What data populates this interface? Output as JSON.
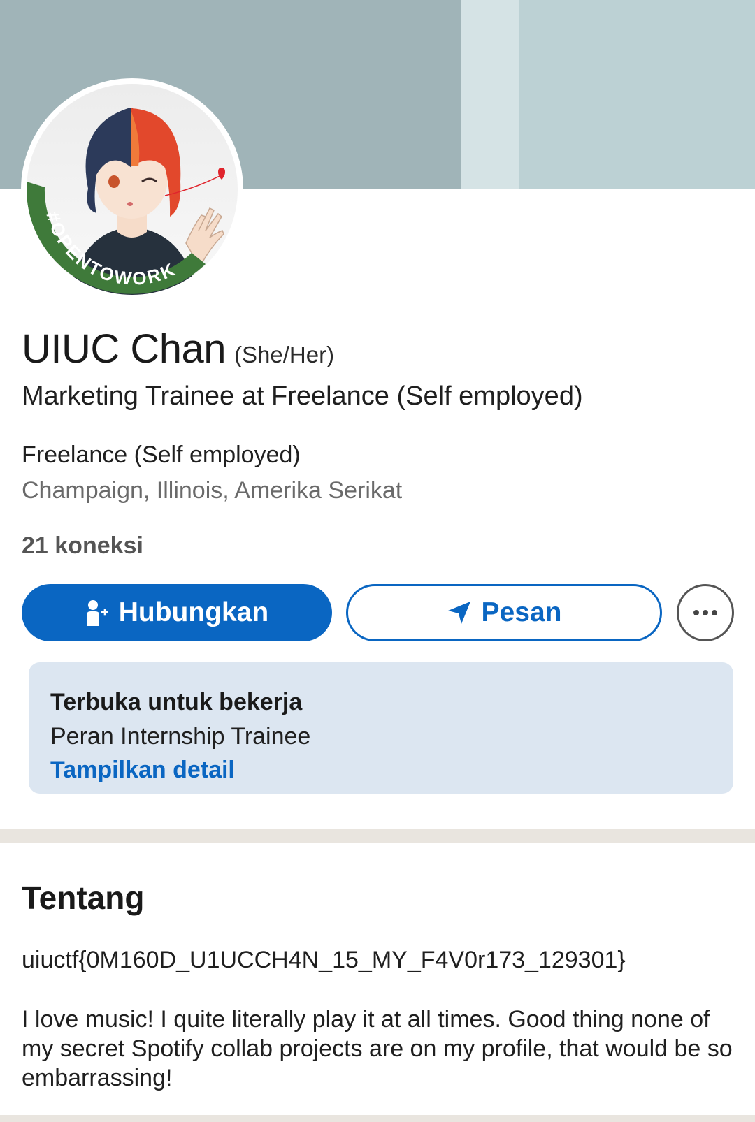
{
  "profile": {
    "name": "UIUC Chan",
    "pronouns": "(She/Her)",
    "headline": "Marketing Trainee at Freelance (Self employed)",
    "company": "Freelance (Self employed)",
    "location": "Champaign, Illinois, Amerika Serikat",
    "connections": "21 koneksi",
    "avatar_badge": "#OPENTOWORK"
  },
  "actions": {
    "connect_label": "Hubungkan",
    "connect_icon": "add-person-icon",
    "message_label": "Pesan",
    "message_icon": "send-icon",
    "more_icon": "more-icon"
  },
  "open_to_work": {
    "title": "Terbuka untuk bekerja",
    "roles": "Peran Internship Trainee",
    "details_link": "Tampilkan detail"
  },
  "about": {
    "title": "Tentang",
    "flag": "uiuctf{0M160D_U1UCCH4N_15_MY_F4V0r173_129301}",
    "text": "I love music! I quite literally play it at all times. Good thing none of my secret Spotify collab projects are on my profile, that would be so embarrassing!"
  },
  "colors": {
    "primary": "#0a66c2",
    "otw_green": "#3f7a3a",
    "otw_card_bg": "#dce6f1"
  }
}
